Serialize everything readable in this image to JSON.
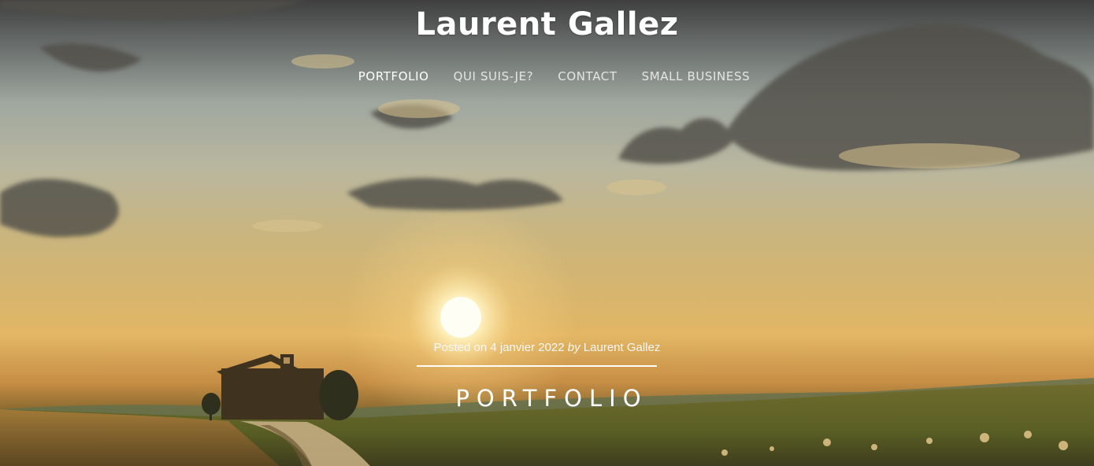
{
  "site": {
    "title": "Laurent Gallez"
  },
  "navigation": {
    "items": [
      {
        "label": "PORTFOLIO",
        "active": true
      },
      {
        "label": "QUI SUIS-JE?",
        "active": false
      },
      {
        "label": "CONTACT",
        "active": false
      },
      {
        "label": "SMALL BUSINESS",
        "active": false
      }
    ]
  },
  "post": {
    "posted_on_label": "Posted on",
    "date": "4 janvier 2022",
    "by_label": "by",
    "author": "Laurent Gallez",
    "title": "PORTFOLIO"
  },
  "colors": {
    "text": "#ffffff",
    "sky_top": "#3f3f3f",
    "sunset": "#e2b664",
    "field": "#6f6b2e"
  }
}
